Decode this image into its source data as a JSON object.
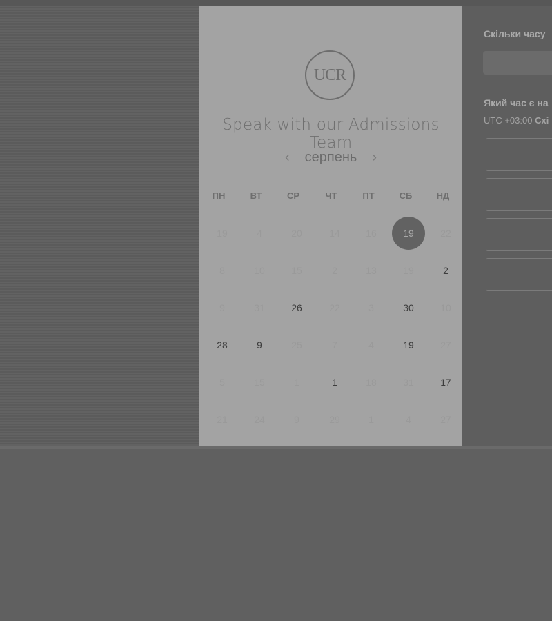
{
  "card": {
    "logo_text": "UCR",
    "title": "Speak with our Admissions Team",
    "month": "серпень",
    "prev_arrow": "‹",
    "next_arrow": "›",
    "weekdays": [
      "ПН",
      "ВТ",
      "СР",
      "ЧТ",
      "ПТ",
      "СБ",
      "НД"
    ],
    "weeks": [
      [
        {
          "d": "19",
          "s": "muted"
        },
        {
          "d": "4",
          "s": "muted"
        },
        {
          "d": "20",
          "s": "muted"
        },
        {
          "d": "14",
          "s": "muted"
        },
        {
          "d": "16",
          "s": "muted"
        },
        {
          "d": "19",
          "s": "selected"
        },
        {
          "d": "22",
          "s": "muted"
        }
      ],
      [
        {
          "d": "8",
          "s": "muted"
        },
        {
          "d": "10",
          "s": "muted"
        },
        {
          "d": "15",
          "s": "muted"
        },
        {
          "d": "2",
          "s": "muted"
        },
        {
          "d": "13",
          "s": "muted"
        },
        {
          "d": "19",
          "s": "muted"
        },
        {
          "d": "2",
          "s": "available"
        }
      ],
      [
        {
          "d": "9",
          "s": "muted"
        },
        {
          "d": "31",
          "s": "muted"
        },
        {
          "d": "26",
          "s": "available"
        },
        {
          "d": "22",
          "s": "muted"
        },
        {
          "d": "3",
          "s": "muted"
        },
        {
          "d": "30",
          "s": "available"
        },
        {
          "d": "10",
          "s": "muted"
        }
      ],
      [
        {
          "d": "28",
          "s": "available"
        },
        {
          "d": "9",
          "s": "available"
        },
        {
          "d": "25",
          "s": "muted"
        },
        {
          "d": "7",
          "s": "muted"
        },
        {
          "d": "4",
          "s": "muted"
        },
        {
          "d": "19",
          "s": "available"
        },
        {
          "d": "27",
          "s": "muted"
        }
      ],
      [
        {
          "d": "5",
          "s": "muted"
        },
        {
          "d": "15",
          "s": "muted"
        },
        {
          "d": "1",
          "s": "muted"
        },
        {
          "d": "1",
          "s": "available"
        },
        {
          "d": "18",
          "s": "muted"
        },
        {
          "d": "31",
          "s": "muted"
        },
        {
          "d": "17",
          "s": "available"
        }
      ],
      [
        {
          "d": "21",
          "s": "muted"
        },
        {
          "d": "24",
          "s": "muted"
        },
        {
          "d": "9",
          "s": "muted"
        },
        {
          "d": "29",
          "s": "muted"
        },
        {
          "d": "1",
          "s": "muted"
        },
        {
          "d": "4",
          "s": "muted"
        },
        {
          "d": "27",
          "s": "muted"
        }
      ]
    ]
  },
  "panel": {
    "duration_question": "Скільки часу",
    "time_question": "Який час є на",
    "timezone_prefix": "UTC +03:00",
    "timezone_name": "Схі"
  }
}
